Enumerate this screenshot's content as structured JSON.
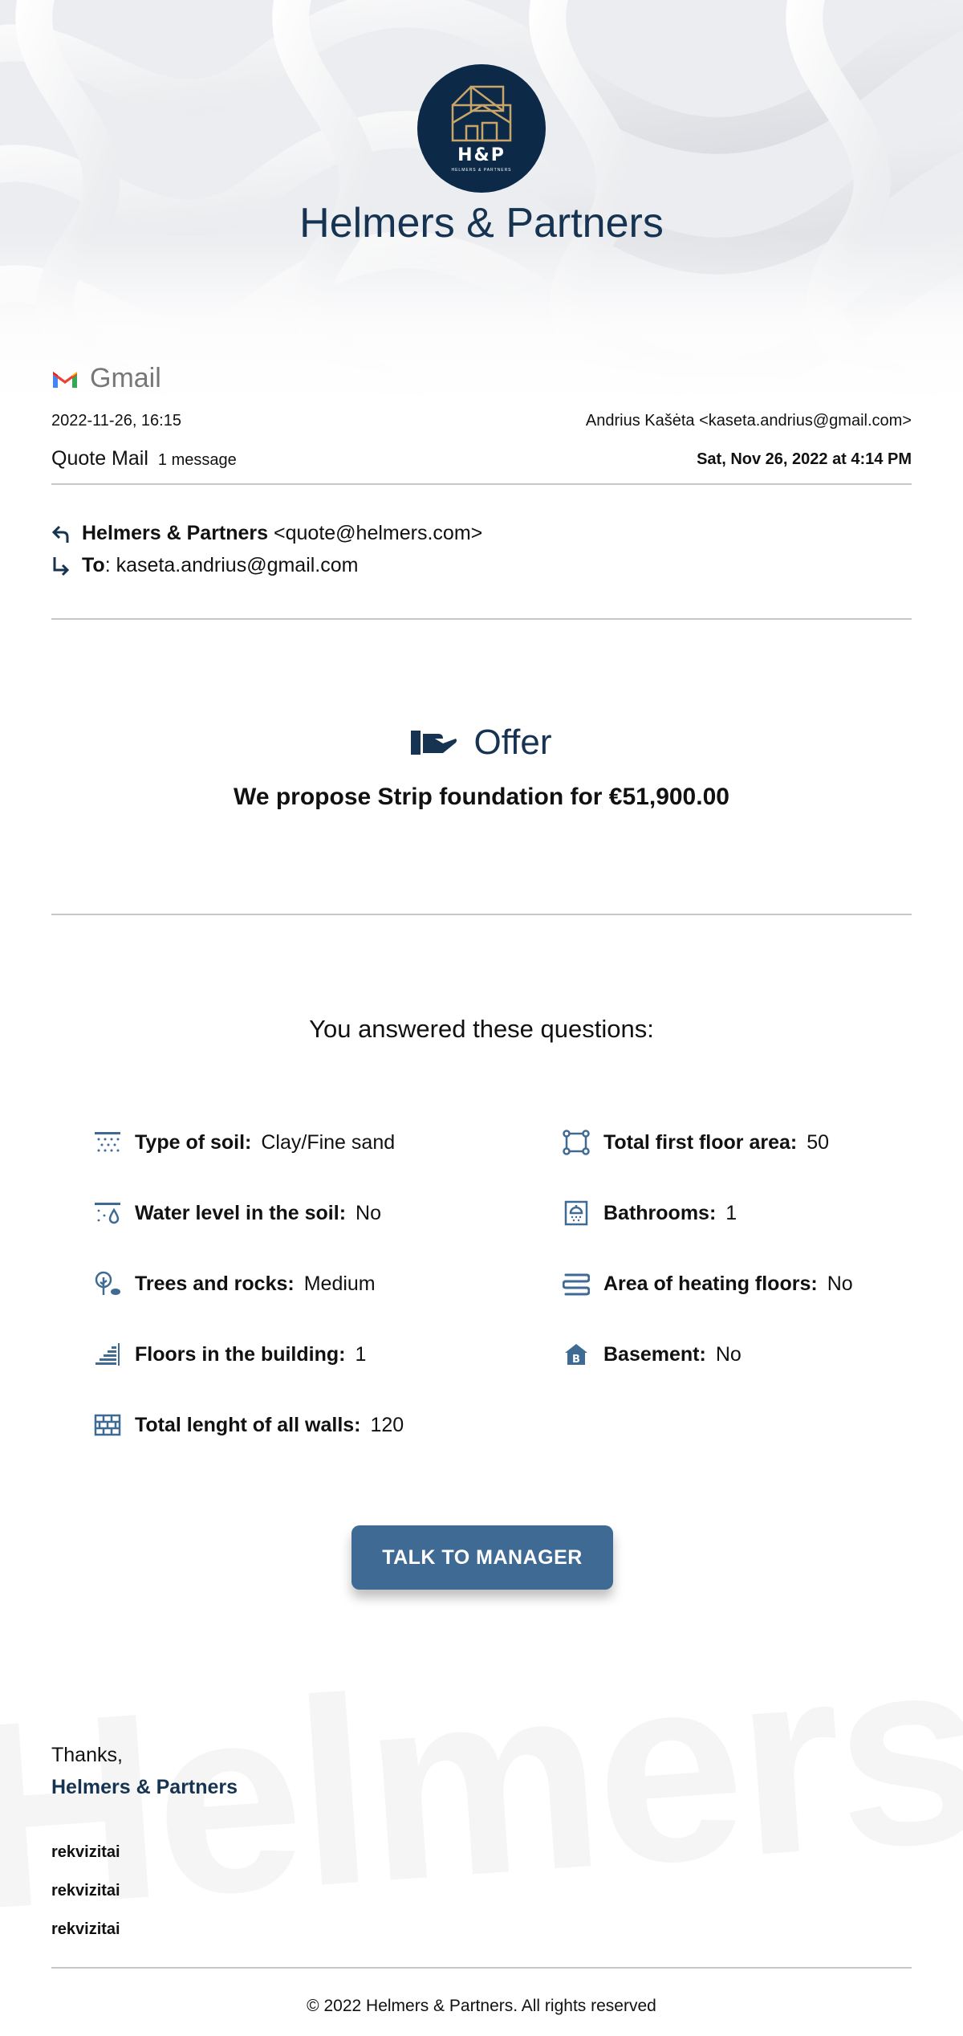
{
  "brand": {
    "monogram": "H&P",
    "logo_subtitle": "HELMERS & PARTNERS",
    "name": "Helmers & Partners"
  },
  "gmail": {
    "label": "Gmail"
  },
  "email_meta": {
    "printed_at": "2022-11-26, 16:15",
    "account": "Andrius Kašėta <kaseta.andrius@gmail.com>",
    "subject": "Quote Mail",
    "message_count": "1 message",
    "sent_at": "Sat, Nov 26, 2022 at 4:14 PM"
  },
  "from": {
    "name": "Helmers & Partners",
    "email": "<quote@helmers.com>"
  },
  "to": {
    "label": "To",
    "email": "kaseta.andrius@gmail.com"
  },
  "offer": {
    "title": "Offer",
    "text": "We propose Strip foundation for €51,900.00"
  },
  "questions": {
    "title": "You answered these questions:",
    "left": [
      {
        "icon": "soil-icon",
        "label": "Type of soil:",
        "value": "Clay/Fine sand"
      },
      {
        "icon": "water-level-icon",
        "label": "Water level in the soil:",
        "value": "No"
      },
      {
        "icon": "trees-rocks-icon",
        "label": "Trees and rocks:",
        "value": "Medium"
      },
      {
        "icon": "floors-icon",
        "label": "Floors in the building:",
        "value": "1"
      },
      {
        "icon": "walls-icon",
        "label": "Total lenght of all walls:",
        "value": "120"
      }
    ],
    "right": [
      {
        "icon": "floor-area-icon",
        "label": "Total first floor area:",
        "value": "50"
      },
      {
        "icon": "bathroom-icon",
        "label": "Bathrooms:",
        "value": "1"
      },
      {
        "icon": "heating-floor-icon",
        "label": "Area of heating floors:",
        "value": "No"
      },
      {
        "icon": "basement-icon",
        "label": "Basement:",
        "value": "No"
      }
    ]
  },
  "cta": {
    "label": "TALK TO MANAGER"
  },
  "closing": {
    "thanks": "Thanks,",
    "signature": "Helmers & Partners",
    "watermark": "Helmers",
    "requisites": [
      "rekvizitai",
      "rekvizitai",
      "rekvizitai"
    ]
  },
  "footer": {
    "copyright": "© 2022 Helmers & Partners. All rights reserved"
  },
  "colors": {
    "navy": "#0c2a48",
    "brand_text": "#163352",
    "button": "#3e6a93",
    "gold": "#c9a56a",
    "icon": "#3e6a93"
  }
}
